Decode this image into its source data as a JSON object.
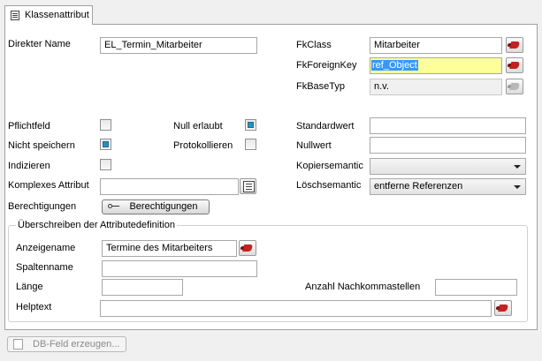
{
  "tab": {
    "title": "Klassenattribut"
  },
  "left": {
    "direkter_name_label": "Direkter Name",
    "direkter_name_value": "EL_Termin_Mitarbeiter",
    "pflichtfeld_label": "Pflichtfeld",
    "nicht_speichern_label": "Nicht speichern",
    "indizieren_label": "Indizieren",
    "null_erlaubt_label": "Null erlaubt",
    "protokollieren_label": "Protokollieren",
    "komplexes_attribut_label": "Komplexes Attribut",
    "komplexes_attribut_value": "",
    "berechtigungen_label": "Berechtigungen",
    "berechtigungen_button": "Berechtigungen"
  },
  "right": {
    "fkclass_label": "FkClass",
    "fkclass_value": "Mitarbeiter",
    "fkforeignkey_label": "FkForeignKey",
    "fkforeignkey_value": "ref_Object",
    "fkbasetyp_label": "FkBaseTyp",
    "fkbasetyp_value": "n.v.",
    "standardwert_label": "Standardwert",
    "standardwert_value": "",
    "nullwert_label": "Nullwert",
    "nullwert_value": "",
    "kopiersemantic_label": "Kopiersemantic",
    "kopiersemantic_value": "",
    "loeschsemantic_label": "Löschsemantic",
    "loeschsemantic_value": "entferne Referenzen"
  },
  "override": {
    "title": "Überschreiben der Attributedefinition",
    "anzeigename_label": "Anzeigename",
    "anzeigename_value": "Termine des Mitarbeiters",
    "spaltenname_label": "Spaltenname",
    "spaltenname_value": "",
    "laenge_label": "Länge",
    "laenge_value": "",
    "nachkommastellen_label": "Anzahl Nachkommastellen",
    "nachkommastellen_value": "",
    "helptext_label": "Helptext",
    "helptext_value": ""
  },
  "footer": {
    "db_button": "DB-Feld erzeugen..."
  },
  "colors": {
    "highlight": "#ffff99",
    "selection": "#3399ff",
    "checked": "#2a8fbd",
    "accent_red": "#c42222"
  },
  "checkboxes": {
    "pflichtfeld": false,
    "nicht_speichern": true,
    "indizieren": false,
    "null_erlaubt": true,
    "protokollieren": false
  }
}
